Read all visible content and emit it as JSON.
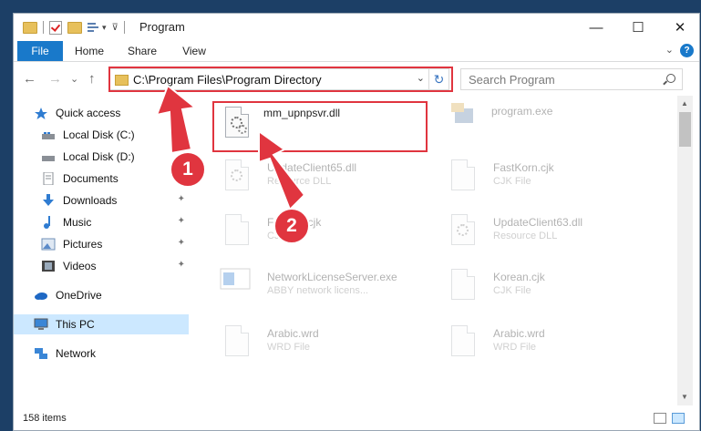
{
  "window": {
    "title": "Program",
    "minimize_glyph": "—",
    "maximize_glyph": "☐",
    "close_glyph": "✕"
  },
  "ribbon": {
    "tabs": [
      "File",
      "Home",
      "Share",
      "View"
    ],
    "help_glyph": "?"
  },
  "nav": {
    "back_glyph": "←",
    "forward_glyph": "→",
    "recent_glyph": "⌄",
    "up_glyph": "↑",
    "address": "C:\\Program Files\\Program Directory",
    "search_placeholder": "Search Program"
  },
  "sidebar": {
    "items": [
      {
        "label": "Quick access",
        "icon": "star-icon",
        "pinned": false
      },
      {
        "label": "Local Disk (C:)",
        "icon": "drive-icon",
        "pinned": false
      },
      {
        "label": "Local Disk (D:)",
        "icon": "drive-icon",
        "pinned": false
      },
      {
        "label": "Documents",
        "icon": "documents-icon",
        "pinned": false
      },
      {
        "label": "Downloads",
        "icon": "download-icon",
        "pinned": true
      },
      {
        "label": "Music",
        "icon": "music-icon",
        "pinned": true
      },
      {
        "label": "Pictures",
        "icon": "pictures-icon",
        "pinned": true
      },
      {
        "label": "Videos",
        "icon": "videos-icon",
        "pinned": true
      },
      {
        "label": "OneDrive",
        "icon": "cloud-icon",
        "pinned": false
      },
      {
        "label": "This PC",
        "icon": "computer-icon",
        "pinned": false
      },
      {
        "label": "Network",
        "icon": "network-icon",
        "pinned": false
      }
    ],
    "selected": "This PC",
    "pin_glyph": "📌"
  },
  "files": [
    {
      "name": "mm_upnpsvr.dll",
      "type": ""
    },
    {
      "name": "program.exe",
      "type": ""
    },
    {
      "name": "UpdateClient65.dll",
      "type": "Resource DLL"
    },
    {
      "name": "FastKorn.cjk",
      "type": "CJK File"
    },
    {
      "name": "FastKor.cjk",
      "type": "CJK File"
    },
    {
      "name": "UpdateClient63.dll",
      "type": "Resource DLL"
    },
    {
      "name": "NetworkLicenseServer.exe",
      "type": "ABBY network licens..."
    },
    {
      "name": "Korean.cjk",
      "type": "CJK File"
    },
    {
      "name": "Arabic.wrd",
      "type": "WRD File"
    },
    {
      "name": "Arabic.wrd",
      "type": "WRD File"
    }
  ],
  "status": {
    "item_count": "158 items"
  },
  "callouts": {
    "one": "1",
    "two": "2"
  },
  "colors": {
    "accent": "#1979ca",
    "highlight": "#e0353f",
    "selection": "#cce8ff",
    "folder": "#e7c05b"
  }
}
